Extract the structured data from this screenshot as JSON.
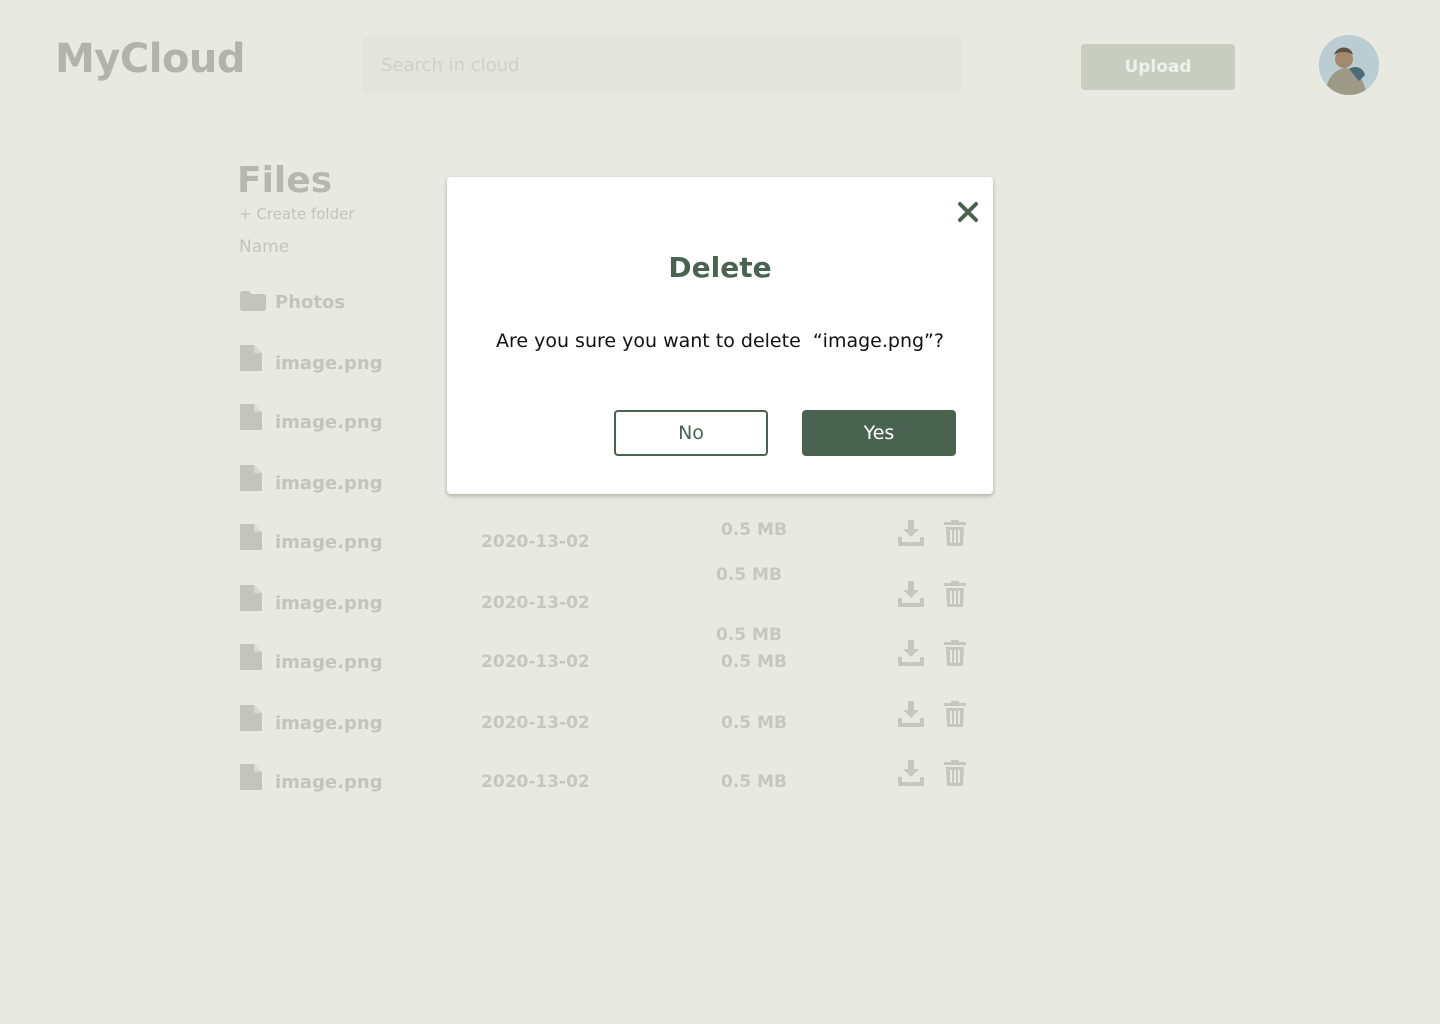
{
  "header": {
    "logo": "MyCloud",
    "search_placeholder": "Search in cloud",
    "upload_label": "Upload"
  },
  "files": {
    "title": "Files",
    "create_folder": "+ Create folder",
    "col_name": "Name",
    "folder": {
      "name": "Photos",
      "icon": "folder-icon"
    },
    "rows": [
      {
        "name": "image.png"
      },
      {
        "name": "image.png"
      },
      {
        "name": "image.png"
      },
      {
        "name": "image.png",
        "date": "2020-13-02",
        "size": "0.5 MB"
      },
      {
        "name": "image.png",
        "date": "2020-13-02",
        "size": "0.5 MB"
      },
      {
        "name": "image.png",
        "date": "2020-13-02",
        "size": "0.5 MB"
      },
      {
        "name": "image.png",
        "date": "2020-13-02",
        "size": "0.5 MB"
      },
      {
        "name": "image.png",
        "date": "2020-13-02",
        "size": "0.5 MB"
      }
    ],
    "extra_sizes": [
      "0.5 MB",
      "0.5 MB"
    ]
  },
  "modal": {
    "title": "Delete",
    "message": "Are you sure you want to delete  “image.png”?",
    "no_label": "No",
    "yes_label": "Yes",
    "close_icon": "close-icon"
  },
  "colors": {
    "background": "#e8e9e0",
    "accent": "#4a6350",
    "modal_bg": "#ffffff"
  }
}
